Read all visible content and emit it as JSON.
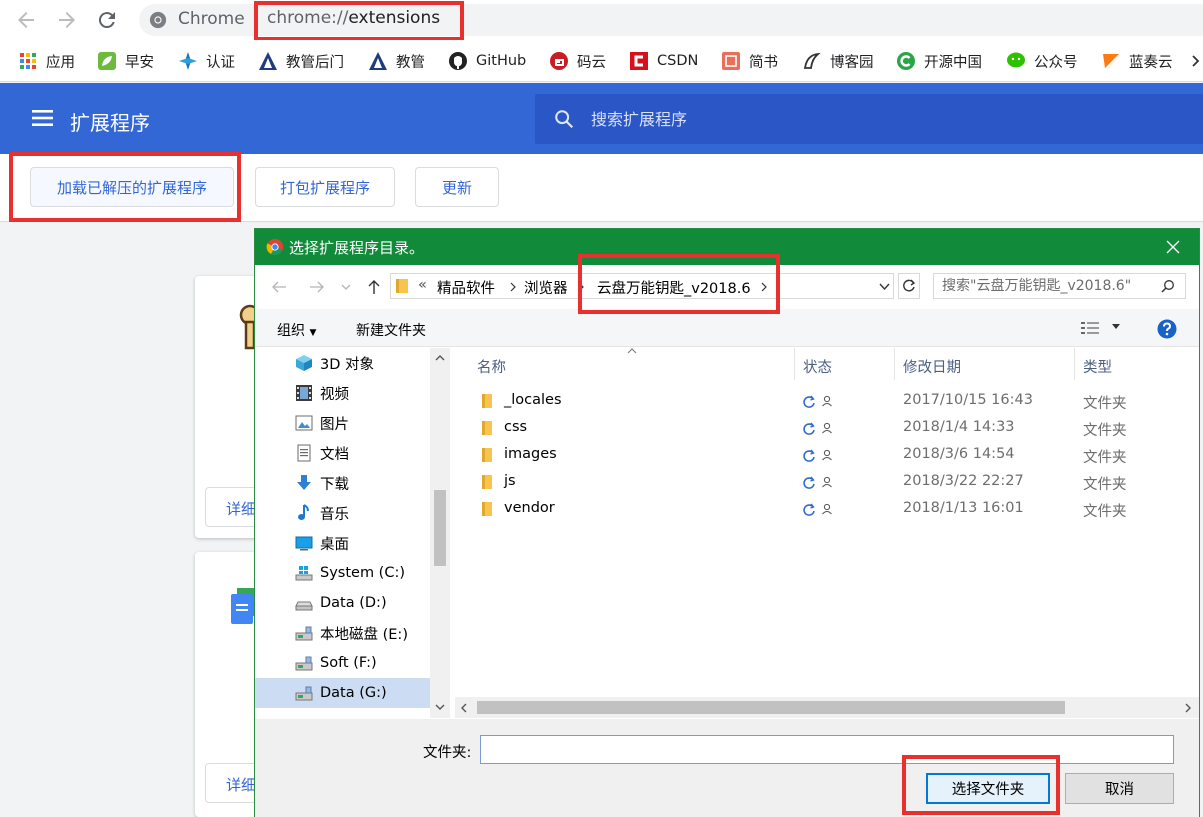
{
  "browser": {
    "site_name": "Chrome",
    "url_scheme": "chrome://",
    "url_path": "extensions"
  },
  "bookmarks": [
    {
      "label": "应用",
      "icon": "apps-grid-icon"
    },
    {
      "label": "早安",
      "icon": "leaf-icon"
    },
    {
      "label": "认证",
      "icon": "compass-icon"
    },
    {
      "label": "教管后门",
      "icon": "school-logo-icon"
    },
    {
      "label": "教管",
      "icon": "school-logo-icon"
    },
    {
      "label": "GitHub",
      "icon": "github-icon"
    },
    {
      "label": "码云",
      "icon": "gitee-icon"
    },
    {
      "label": "CSDN",
      "icon": "csdn-icon"
    },
    {
      "label": "简书",
      "icon": "jianshu-icon"
    },
    {
      "label": "博客园",
      "icon": "cnblogs-icon"
    },
    {
      "label": "开源中国",
      "icon": "oschina-icon"
    },
    {
      "label": "公众号",
      "icon": "wechat-icon"
    },
    {
      "label": "蓝奏云",
      "icon": "lanzou-icon"
    }
  ],
  "extensions_page": {
    "title": "扩展程序",
    "search_placeholder": "搜索扩展程序",
    "load_unpacked_label": "加载已解压的扩展程序",
    "pack_label": "打包扩展程序",
    "update_label": "更新",
    "card_details_label": "详细"
  },
  "dialog": {
    "title": "选择扩展程序目录。",
    "breadcrumb": {
      "overflow": "«",
      "items": [
        "精品软件",
        "浏览器",
        "云盘万能钥匙_v2018.6"
      ]
    },
    "search_placeholder": "搜索\"云盘万能钥匙_v2018.6\"",
    "organize_label": "组织",
    "new_folder_label": "新建文件夹",
    "nav_items": [
      {
        "label": "3D 对象",
        "icon": "cube-3d-icon"
      },
      {
        "label": "视频",
        "icon": "video-film-icon"
      },
      {
        "label": "图片",
        "icon": "picture-icon"
      },
      {
        "label": "文档",
        "icon": "document-icon"
      },
      {
        "label": "下载",
        "icon": "download-arrow-icon"
      },
      {
        "label": "音乐",
        "icon": "music-note-icon"
      },
      {
        "label": "桌面",
        "icon": "desktop-icon"
      },
      {
        "label": "System (C:)",
        "icon": "windows-drive-icon"
      },
      {
        "label": "Data  (D:)",
        "icon": "drive-icon"
      },
      {
        "label": "本地磁盘 (E:)",
        "icon": "network-drive-icon"
      },
      {
        "label": "Soft (F:)",
        "icon": "network-drive-icon"
      },
      {
        "label": "Data (G:)",
        "icon": "network-drive-icon"
      }
    ],
    "selected_nav": "Data (G:)",
    "columns": {
      "name": "名称",
      "status": "状态",
      "date": "修改日期",
      "type": "类型"
    },
    "files": [
      {
        "name": "_locales",
        "date": "2017/10/15 16:43",
        "type": "文件夹"
      },
      {
        "name": "css",
        "date": "2018/1/4 14:33",
        "type": "文件夹"
      },
      {
        "name": "images",
        "date": "2018/3/6 14:54",
        "type": "文件夹"
      },
      {
        "name": "js",
        "date": "2018/3/22 22:27",
        "type": "文件夹"
      },
      {
        "name": "vendor",
        "date": "2018/1/13 16:01",
        "type": "文件夹"
      }
    ],
    "folder_label": "文件夹:",
    "folder_value": "",
    "select_button": "选择文件夹",
    "cancel_button": "取消"
  },
  "colors": {
    "ext_header": "#3367d6",
    "dialog_titlebar": "#118a3a",
    "highlight": "#e8302e",
    "folder": "#f8c44f"
  }
}
